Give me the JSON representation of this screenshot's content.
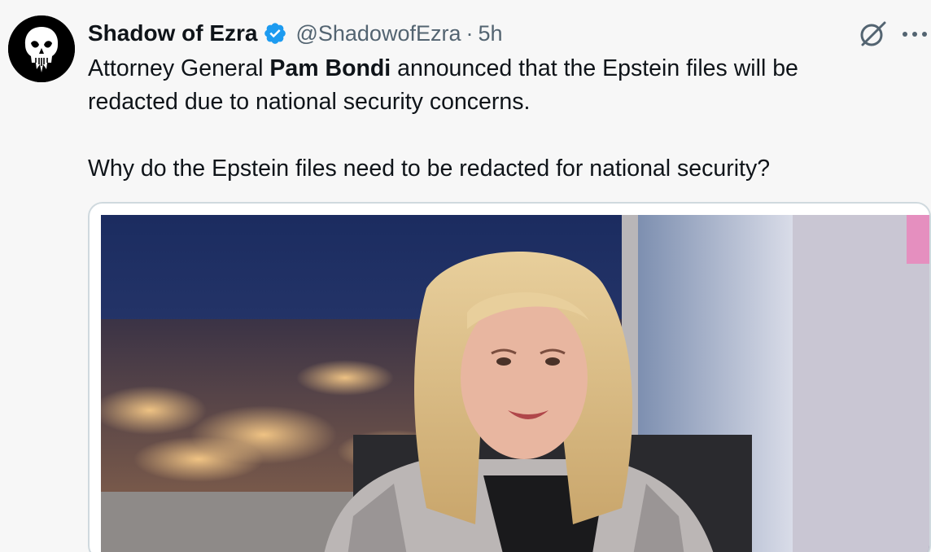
{
  "tweet": {
    "author": {
      "display_name": "Shadow of Ezra",
      "handle": "@ShadowofEzra",
      "verified_icon": "verified-badge-icon",
      "avatar_icon": "skull-avatar-icon"
    },
    "separator": "·",
    "time": "5h",
    "text": {
      "line1_prefix": "Attorney General ",
      "line1_bold": "Pam Bondi",
      "line1_suffix": " announced that the Epstein files will be redacted due to national security concerns.",
      "paragraph2": "Why do the Epstein files need to be redacted for national security?"
    },
    "actions": {
      "grok_icon": "grok-icon",
      "more_icon": "more-icon"
    },
    "media": {
      "type": "video-thumbnail"
    }
  },
  "colors": {
    "background": "#f7f7f7",
    "text": "#0f1419",
    "secondary": "#536471",
    "verified_blue": "#1d9bf0",
    "media_border": "#cfd9de"
  }
}
